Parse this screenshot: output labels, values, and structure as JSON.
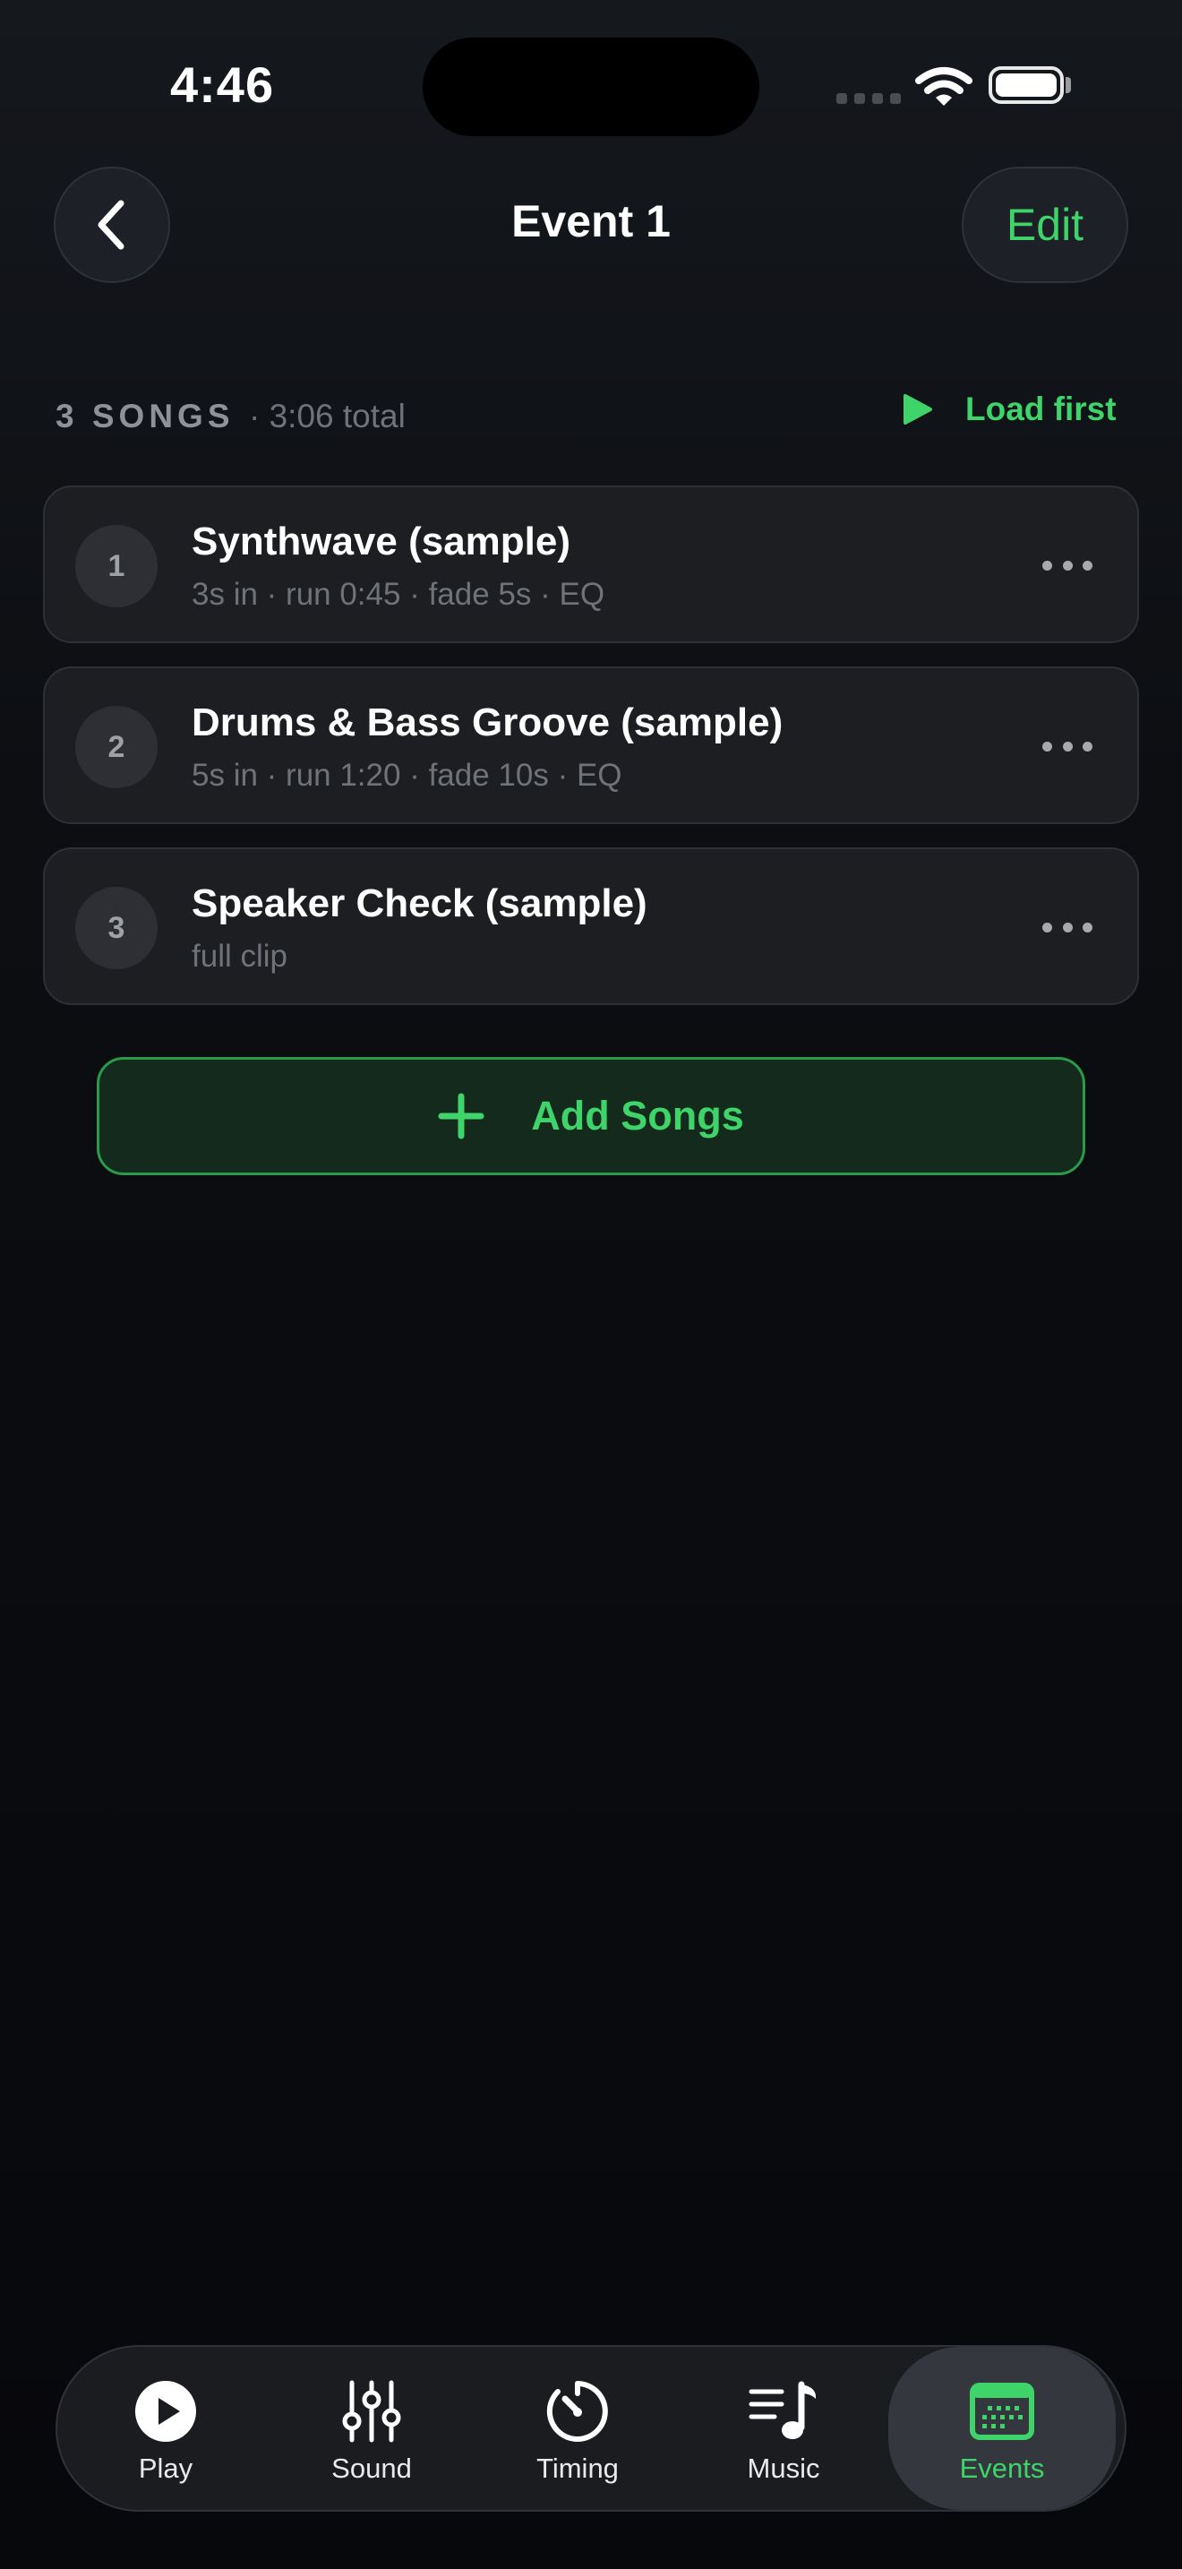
{
  "status_bar": {
    "time": "4:46"
  },
  "nav": {
    "title": "Event 1",
    "edit_label": "Edit",
    "back_icon": "chevron-left-icon"
  },
  "section": {
    "count_label": "3 SONGS",
    "total_label": "· 3:06 total",
    "load_first_label": "Load first"
  },
  "songs": [
    {
      "number": "1",
      "title": "Synthwave (sample)",
      "meta": "3s in · run 0:45 · fade 5s · EQ"
    },
    {
      "number": "2",
      "title": "Drums & Bass Groove (sample)",
      "meta": "5s in · run 1:20 · fade 10s · EQ"
    },
    {
      "number": "3",
      "title": "Speaker Check (sample)",
      "meta": "full clip"
    }
  ],
  "add_songs_label": "Add Songs",
  "tabs": [
    {
      "label": "Play",
      "icon": "play-circle-icon",
      "active": false
    },
    {
      "label": "Sound",
      "icon": "sliders-icon",
      "active": false
    },
    {
      "label": "Timing",
      "icon": "timer-icon",
      "active": false
    },
    {
      "label": "Music",
      "icon": "music-list-icon",
      "active": false
    },
    {
      "label": "Events",
      "icon": "calendar-icon",
      "active": true
    }
  ],
  "colors": {
    "accent": "#3fd46a",
    "background": "#0c0e12",
    "card": "#1c1e22"
  }
}
